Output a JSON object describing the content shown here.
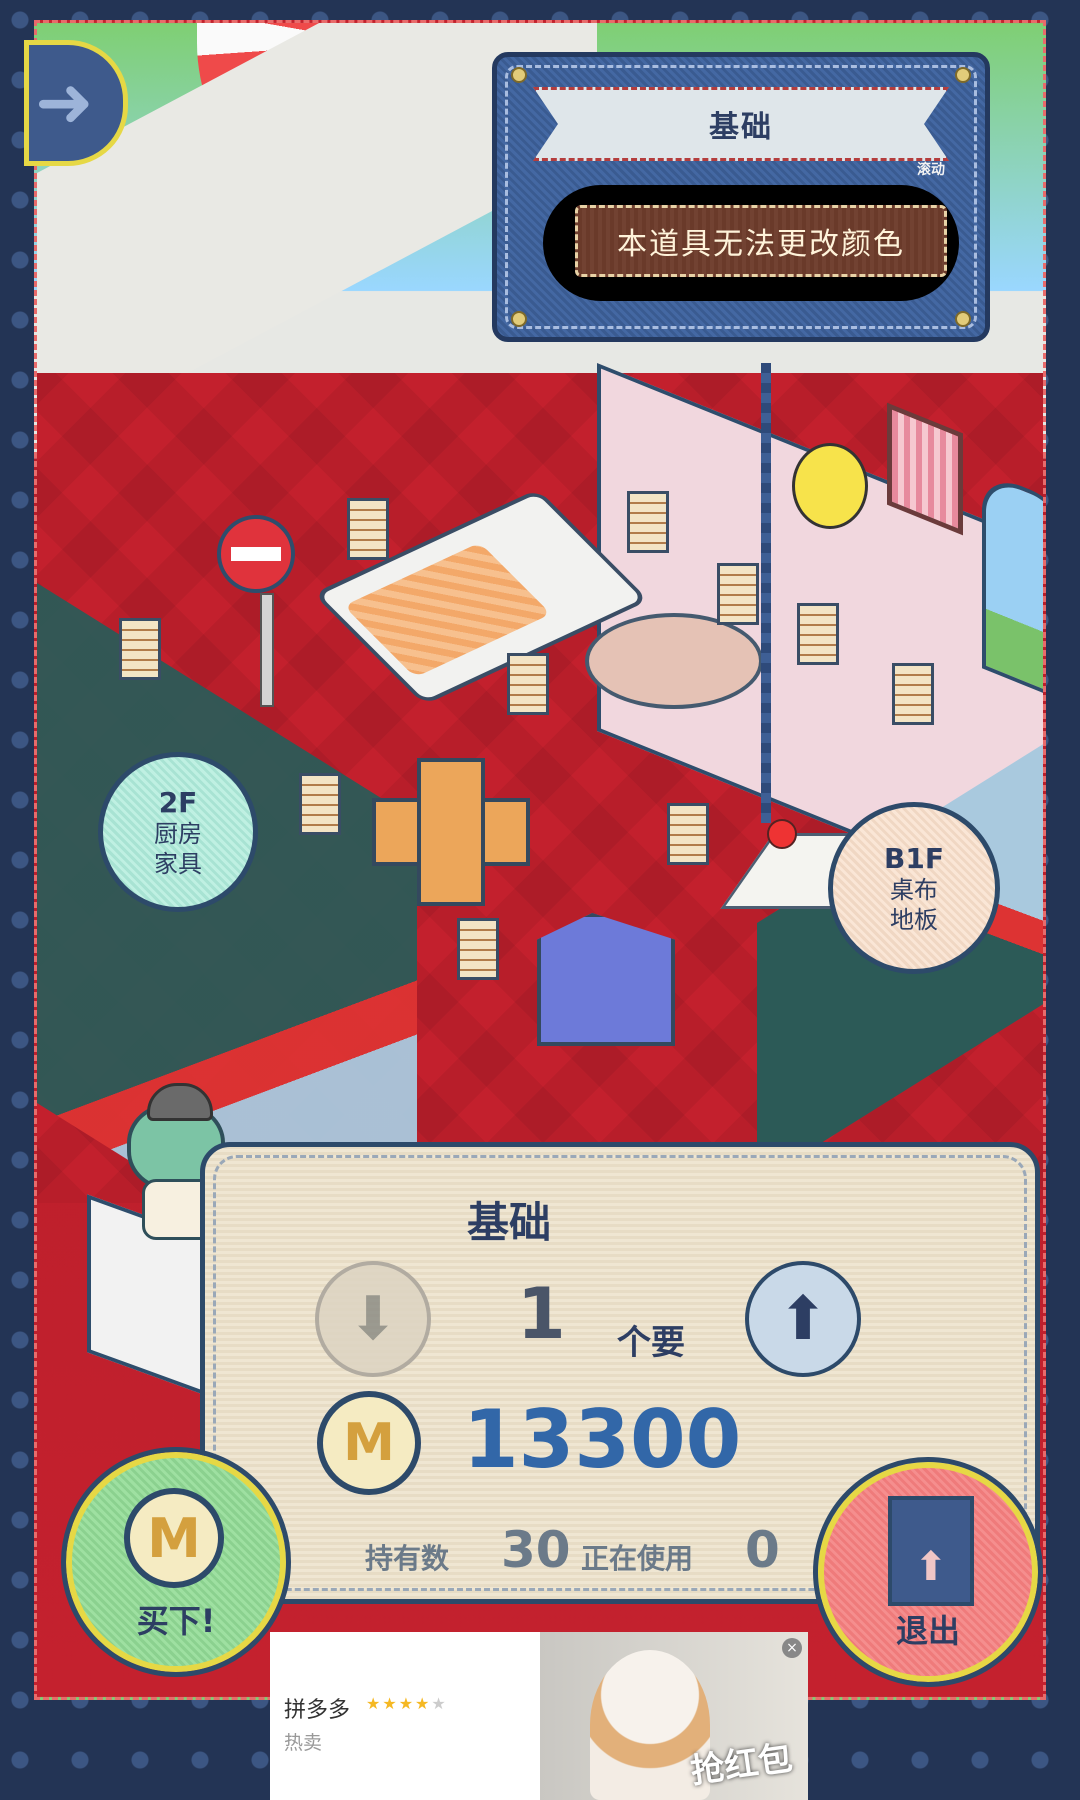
{
  "sign": {
    "ribbon_title": "基础",
    "small_label": "滚动",
    "message": "本道具无法更改颜色"
  },
  "floors": {
    "up": {
      "level": "2F",
      "line1": "厨房",
      "line2": "家具"
    },
    "down": {
      "level": "B1F",
      "line1": "桌布",
      "line2": "地板"
    }
  },
  "panel": {
    "title": "基础",
    "quantity": "1",
    "unit": "个要",
    "coin_symbol": "M",
    "price": "13300",
    "owned_label": "持有数",
    "owned_value": "30",
    "in_use_label": "正在使用",
    "in_use_value": "0"
  },
  "buttons": {
    "back_icon": "arrow-right-icon",
    "decrease_icon": "arrow-down-icon",
    "increase_icon": "arrow-up-icon",
    "buy_label": "买下!",
    "buy_coin": "M",
    "exit_label": "退出"
  },
  "ad": {
    "brand": "拼多多",
    "rating": 4,
    "tag": "热卖",
    "overlay_text": "抢红包",
    "close_icon": "×"
  },
  "colors": {
    "price": "#3267a8",
    "buy_button": "#8bd18f",
    "exit_button": "#ef7b7b",
    "frame": "#233455"
  }
}
